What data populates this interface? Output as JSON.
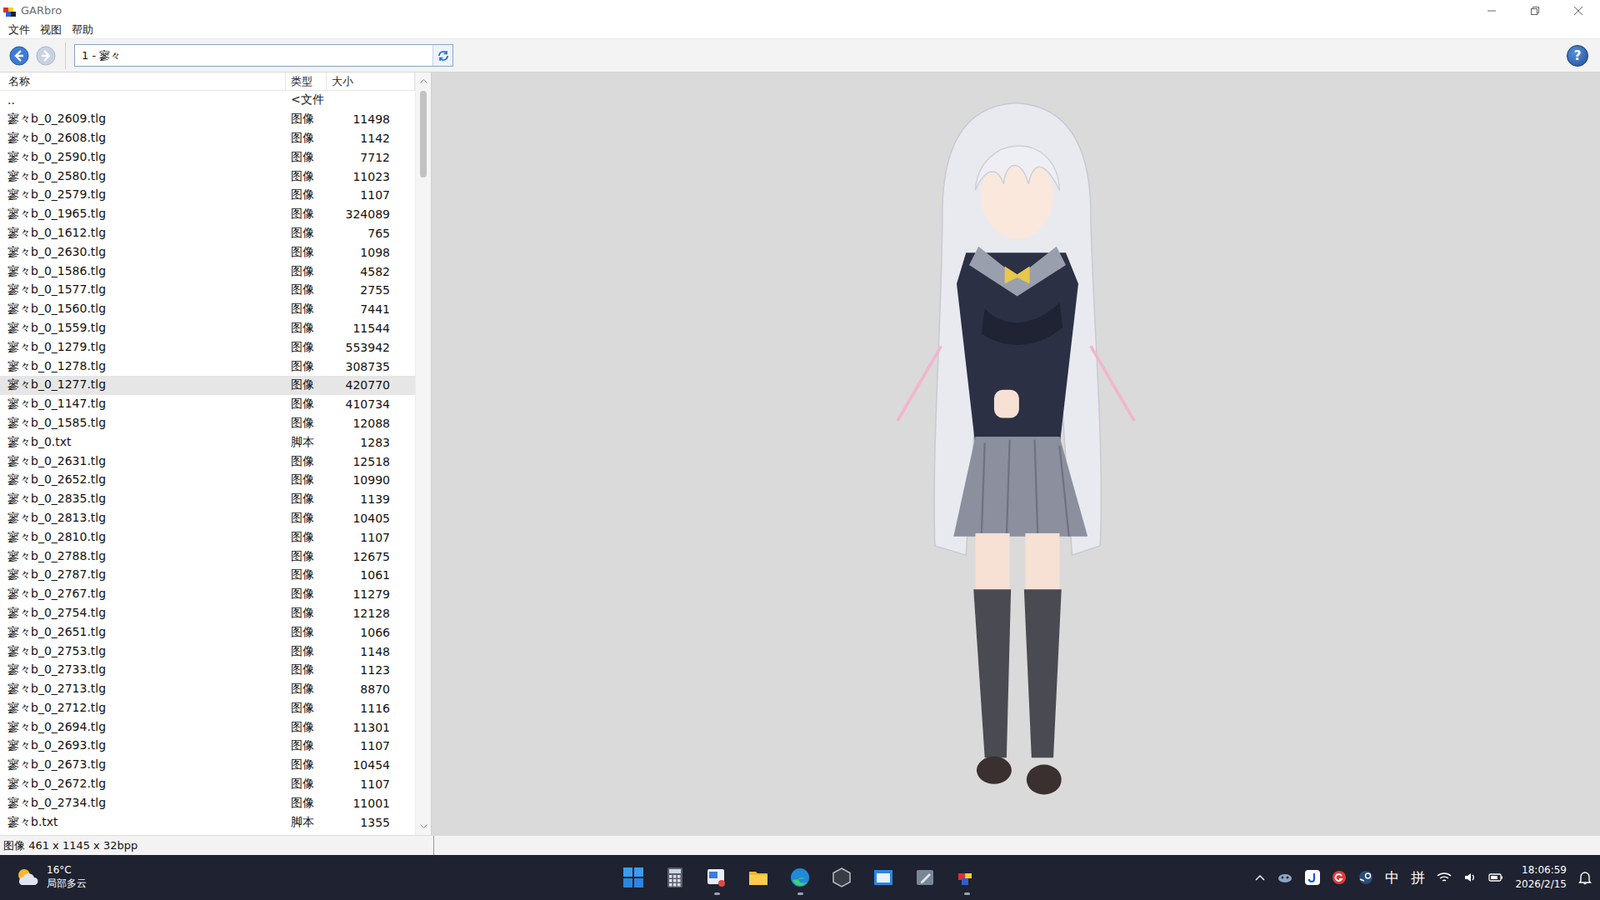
{
  "window": {
    "title": "GARbro"
  },
  "menu": [
    "文件",
    "视图",
    "帮助"
  ],
  "toolbar": {
    "path": "1 - 寥々",
    "help": "?"
  },
  "table": {
    "columns": [
      "名称",
      "类型",
      "大小"
    ],
    "rows": [
      {
        "name": "..",
        "type": "<文件",
        "size": "",
        "selected": false
      },
      {
        "name": "寥々b_0_2609.tlg",
        "type": "图像",
        "size": "11498",
        "selected": false
      },
      {
        "name": "寥々b_0_2608.tlg",
        "type": "图像",
        "size": "1142",
        "selected": false
      },
      {
        "name": "寥々b_0_2590.tlg",
        "type": "图像",
        "size": "7712",
        "selected": false
      },
      {
        "name": "寥々b_0_2580.tlg",
        "type": "图像",
        "size": "11023",
        "selected": false
      },
      {
        "name": "寥々b_0_2579.tlg",
        "type": "图像",
        "size": "1107",
        "selected": false
      },
      {
        "name": "寥々b_0_1965.tlg",
        "type": "图像",
        "size": "324089",
        "selected": false
      },
      {
        "name": "寥々b_0_1612.tlg",
        "type": "图像",
        "size": "765",
        "selected": false
      },
      {
        "name": "寥々b_0_2630.tlg",
        "type": "图像",
        "size": "1098",
        "selected": false
      },
      {
        "name": "寥々b_0_1586.tlg",
        "type": "图像",
        "size": "4582",
        "selected": false
      },
      {
        "name": "寥々b_0_1577.tlg",
        "type": "图像",
        "size": "2755",
        "selected": false
      },
      {
        "name": "寥々b_0_1560.tlg",
        "type": "图像",
        "size": "7441",
        "selected": false
      },
      {
        "name": "寥々b_0_1559.tlg",
        "type": "图像",
        "size": "11544",
        "selected": false
      },
      {
        "name": "寥々b_0_1279.tlg",
        "type": "图像",
        "size": "553942",
        "selected": false
      },
      {
        "name": "寥々b_0_1278.tlg",
        "type": "图像",
        "size": "308735",
        "selected": false
      },
      {
        "name": "寥々b_0_1277.tlg",
        "type": "图像",
        "size": "420770",
        "selected": true
      },
      {
        "name": "寥々b_0_1147.tlg",
        "type": "图像",
        "size": "410734",
        "selected": false
      },
      {
        "name": "寥々b_0_1585.tlg",
        "type": "图像",
        "size": "12088",
        "selected": false
      },
      {
        "name": "寥々b_0.txt",
        "type": "脚本",
        "size": "1283",
        "selected": false
      },
      {
        "name": "寥々b_0_2631.tlg",
        "type": "图像",
        "size": "12518",
        "selected": false
      },
      {
        "name": "寥々b_0_2652.tlg",
        "type": "图像",
        "size": "10990",
        "selected": false
      },
      {
        "name": "寥々b_0_2835.tlg",
        "type": "图像",
        "size": "1139",
        "selected": false
      },
      {
        "name": "寥々b_0_2813.tlg",
        "type": "图像",
        "size": "10405",
        "selected": false
      },
      {
        "name": "寥々b_0_2810.tlg",
        "type": "图像",
        "size": "1107",
        "selected": false
      },
      {
        "name": "寥々b_0_2788.tlg",
        "type": "图像",
        "size": "12675",
        "selected": false
      },
      {
        "name": "寥々b_0_2787.tlg",
        "type": "图像",
        "size": "1061",
        "selected": false
      },
      {
        "name": "寥々b_0_2767.tlg",
        "type": "图像",
        "size": "11279",
        "selected": false
      },
      {
        "name": "寥々b_0_2754.tlg",
        "type": "图像",
        "size": "12128",
        "selected": false
      },
      {
        "name": "寥々b_0_2651.tlg",
        "type": "图像",
        "size": "1066",
        "selected": false
      },
      {
        "name": "寥々b_0_2753.tlg",
        "type": "图像",
        "size": "1148",
        "selected": false
      },
      {
        "name": "寥々b_0_2733.tlg",
        "type": "图像",
        "size": "1123",
        "selected": false
      },
      {
        "name": "寥々b_0_2713.tlg",
        "type": "图像",
        "size": "8870",
        "selected": false
      },
      {
        "name": "寥々b_0_2712.tlg",
        "type": "图像",
        "size": "1116",
        "selected": false
      },
      {
        "name": "寥々b_0_2694.tlg",
        "type": "图像",
        "size": "11301",
        "selected": false
      },
      {
        "name": "寥々b_0_2693.tlg",
        "type": "图像",
        "size": "1107",
        "selected": false
      },
      {
        "name": "寥々b_0_2673.tlg",
        "type": "图像",
        "size": "10454",
        "selected": false
      },
      {
        "name": "寥々b_0_2672.tlg",
        "type": "图像",
        "size": "1107",
        "selected": false
      },
      {
        "name": "寥々b_0_2734.tlg",
        "type": "图像",
        "size": "11001",
        "selected": false
      },
      {
        "name": "寥々b.txt",
        "type": "脚本",
        "size": "1355",
        "selected": false
      }
    ]
  },
  "status_bar": "图像 461 x 1145 x 32bpp",
  "taskbar": {
    "weather": {
      "temp": "16°C",
      "condition": "局部多云"
    },
    "apps": [
      {
        "kind": "start",
        "running": false
      },
      {
        "kind": "calculator",
        "running": false
      },
      {
        "kind": "snip",
        "running": true
      },
      {
        "kind": "folder",
        "running": false
      },
      {
        "kind": "edge",
        "running": true
      },
      {
        "kind": "hex",
        "running": false
      },
      {
        "kind": "store",
        "running": false
      },
      {
        "kind": "pen",
        "running": false
      },
      {
        "kind": "garbro",
        "running": true
      }
    ],
    "tray": {
      "ime": [
        "中",
        "拼"
      ],
      "time": "18:06:59",
      "date": "2026/2/15"
    }
  }
}
